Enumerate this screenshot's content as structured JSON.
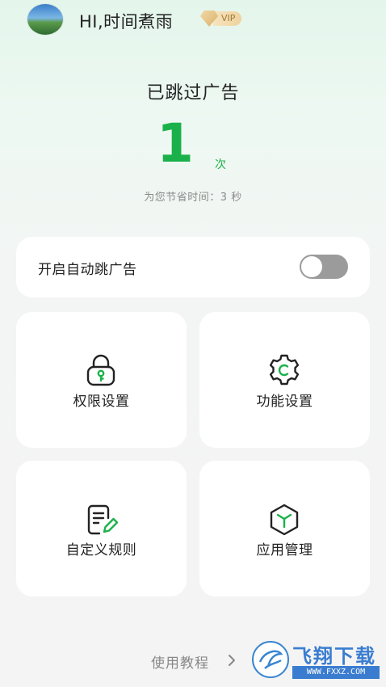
{
  "header": {
    "greeting": "HI,时间煮雨",
    "vip_label": "VIP"
  },
  "stats": {
    "title": "已跳过广告",
    "count": "1",
    "unit": "次",
    "saved_text": "为您节省时间：3 秒"
  },
  "auto_skip": {
    "label": "开启自动跳广告",
    "enabled": false
  },
  "tiles": [
    {
      "label": "权限设置",
      "icon": "lock-key-icon"
    },
    {
      "label": "功能设置",
      "icon": "gear-c-icon"
    },
    {
      "label": "自定义规则",
      "icon": "document-edit-icon"
    },
    {
      "label": "应用管理",
      "icon": "box-icon"
    }
  ],
  "footer": {
    "tutorial_label": "使用教程"
  },
  "watermark": {
    "name": "飞翔下载",
    "url": "WWW.FXXZ.COM"
  },
  "colors": {
    "accent": "#1bb14a",
    "switch_off": "#9b9b9b"
  }
}
